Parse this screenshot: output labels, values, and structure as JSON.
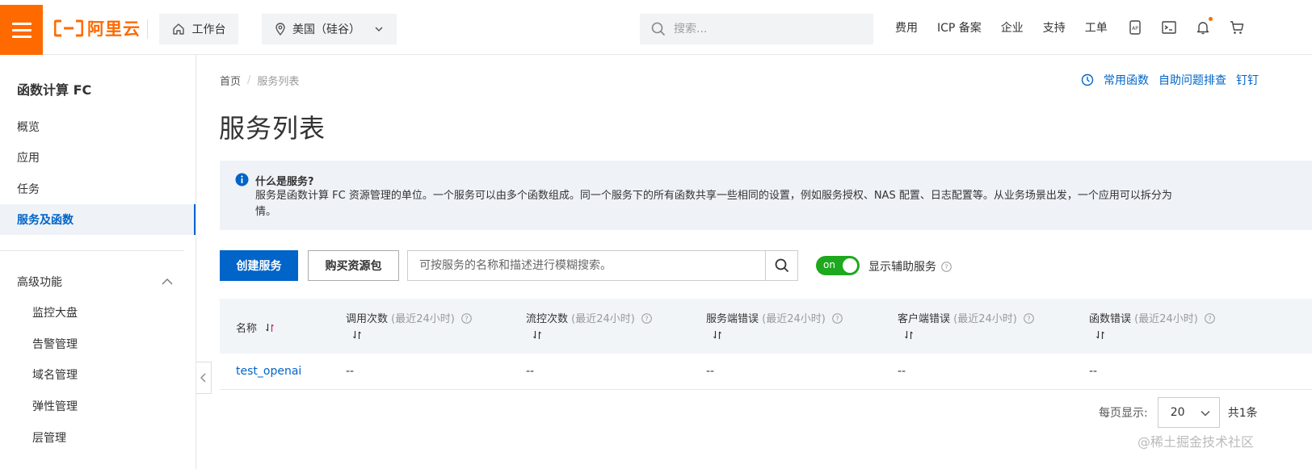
{
  "header": {
    "logo_text": "阿里云",
    "workbench_label": "工作台",
    "region_label": "美国（硅谷）",
    "search_placeholder": "搜索...",
    "nav_links": [
      "费用",
      "ICP 备案",
      "企业",
      "支持",
      "工单"
    ],
    "accent_color": "#ff6a00"
  },
  "sidebar": {
    "product_title": "函数计算 FC",
    "items": [
      {
        "label": "概览",
        "active": false
      },
      {
        "label": "应用",
        "active": false
      },
      {
        "label": "任务",
        "active": false
      },
      {
        "label": "服务及函数",
        "active": true
      }
    ],
    "group": {
      "label": "高级功能",
      "expanded": true,
      "items": [
        "监控大盘",
        "告警管理",
        "域名管理",
        "弹性管理",
        "层管理"
      ]
    }
  },
  "main": {
    "breadcrumb": [
      "首页",
      "服务列表"
    ],
    "top_links": [
      "常用函数",
      "自助问题排查",
      "钉钉"
    ],
    "page_title": "服务列表",
    "info": {
      "title": "什么是服务?",
      "text": "服务是函数计算 FC 资源管理的单位。一个服务可以由多个函数组成。同一个服务下的所有函数共享一些相同的设置，例如服务授权、NAS 配置、日志配置等。从业务场景出发，一个应用可以拆分为",
      "text_cont": "情。"
    },
    "toolbar": {
      "create_label": "创建服务",
      "buy_label": "购买资源包",
      "search_placeholder": "可按服务的名称和描述进行模糊搜索。",
      "toggle_label": "on",
      "toggle_text": "显示辅助服务"
    },
    "table": {
      "columns": [
        {
          "label": "名称",
          "hint": ""
        },
        {
          "label": "调用次数",
          "hint": " (最近24小时)"
        },
        {
          "label": "流控次数",
          "hint": " (最近24小时)"
        },
        {
          "label": "服务端错误",
          "hint": " (最近24小时)"
        },
        {
          "label": "客户端错误",
          "hint": " (最近24小时)"
        },
        {
          "label": "函数错误",
          "hint": " (最近24小时)"
        }
      ],
      "rows": [
        [
          "test_openai",
          "--",
          "--",
          "--",
          "--",
          "--"
        ]
      ]
    },
    "pager": {
      "per_page_label": "每页显示:",
      "page_size": "20",
      "total": "共1条"
    },
    "watermark": "@稀土掘金技术社区"
  },
  "colors": {
    "primary": "#0064c8",
    "toggle_on": "#1da81d",
    "info_bg": "#eff3f8"
  }
}
